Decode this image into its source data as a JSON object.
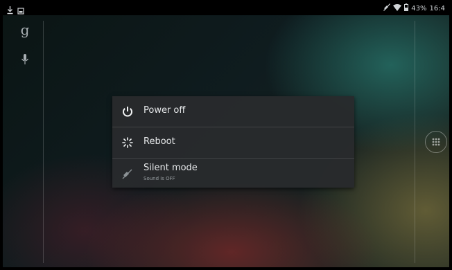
{
  "status_bar": {
    "battery": "43%",
    "time": "16:4",
    "icons": [
      "download-icon",
      "image-icon",
      "silent-icon",
      "wifi-icon",
      "battery-icon"
    ]
  },
  "home": {
    "icons": [
      "google-search-icon",
      "microphone-icon",
      "apps-icon"
    ]
  },
  "power_menu": {
    "items": [
      {
        "label": "Power off",
        "icon": "power-icon"
      },
      {
        "label": "Reboot",
        "icon": "reboot-icon"
      },
      {
        "label": "Silent mode",
        "sublabel": "Sound is OFF",
        "icon": "sound-off-icon"
      }
    ]
  }
}
